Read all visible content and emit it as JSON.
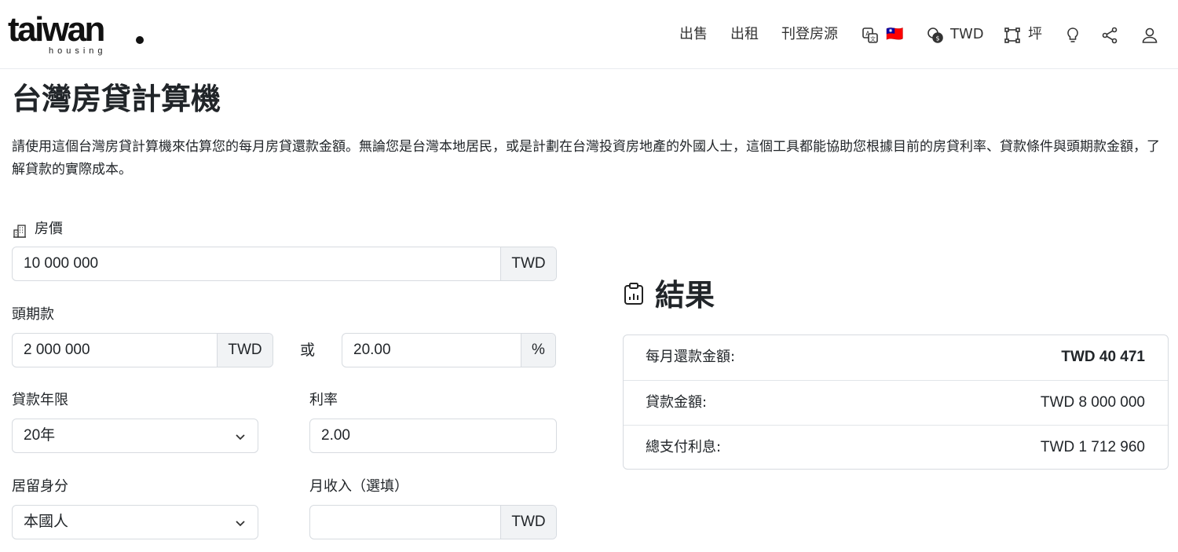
{
  "brand": {
    "name": "taiwan",
    "tagline": "housing"
  },
  "nav": {
    "sell": "出售",
    "rent": "出租",
    "list_property": "刊登房源",
    "language_icon": "translate-icon",
    "flag": "🇹🇼",
    "currency": "TWD",
    "unit": "坪",
    "icons": [
      "translate-icon",
      "currency-icon",
      "area-unit-icon",
      "lightbulb-icon",
      "share-icon",
      "user-icon"
    ]
  },
  "page": {
    "title": "台灣房貸計算機",
    "intro": "請使用這個台灣房貸計算機來估算您的每月房貸還款金額。無論您是台灣本地居民，或是計劃在台灣投資房地產的外國人士，這個工具都能協助您根據目前的房貸利率、貸款條件與頭期款金額，了解貸款的實際成本。"
  },
  "form": {
    "price": {
      "label": "房價",
      "value": "10 000 000",
      "currency": "TWD"
    },
    "down_payment": {
      "label": "頭期款",
      "amount": "2 000 000",
      "currency": "TWD",
      "or": "或",
      "percent": "20.00",
      "percent_sign": "%"
    },
    "loan_term": {
      "label": "貸款年限",
      "selected": "20年"
    },
    "interest_rate": {
      "label": "利率",
      "value": "2.00"
    },
    "residency": {
      "label": "居留身分",
      "selected": "本國人"
    },
    "monthly_income": {
      "label": "月收入（選填）",
      "value": "",
      "currency": "TWD"
    }
  },
  "results": {
    "title": "結果",
    "rows": [
      {
        "label": "每月還款金額:",
        "value": "TWD 40 471"
      },
      {
        "label": "貸款金額:",
        "value": "TWD 8 000 000"
      },
      {
        "label": "總支付利息:",
        "value": "TWD 1 712 960"
      }
    ]
  },
  "colors": {
    "border": "#d7dbe0",
    "addon_bg": "#f1f3f5",
    "text": "#212529"
  }
}
